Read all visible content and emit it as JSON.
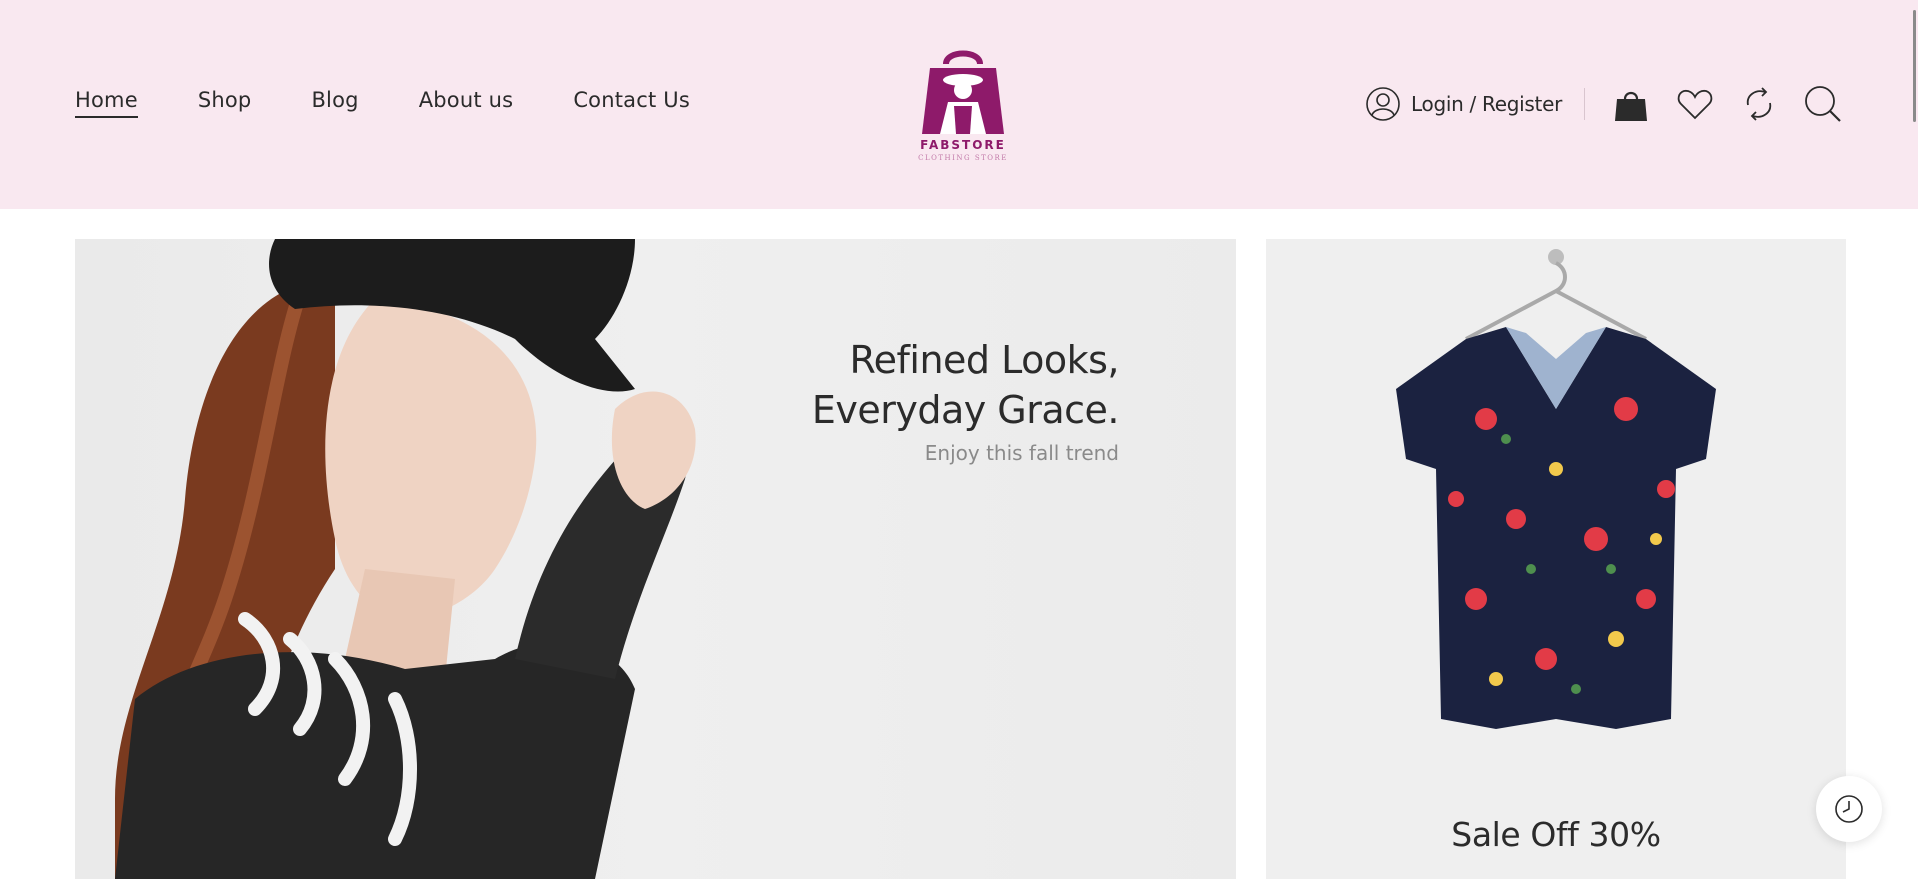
{
  "nav": {
    "items": [
      {
        "label": "Home",
        "active": true
      },
      {
        "label": "Shop",
        "active": false
      },
      {
        "label": "Blog",
        "active": false
      },
      {
        "label": "About us",
        "active": false
      },
      {
        "label": "Contact Us",
        "active": false
      }
    ]
  },
  "logo": {
    "name": "FABSTORE",
    "tagline": "CLOTHING STORE",
    "color": "#8e1a6a"
  },
  "account": {
    "login_label": "Login / Register",
    "icon": "user-icon"
  },
  "tools": {
    "icons": [
      "shopping-bag-icon",
      "heart-icon",
      "compare-icon",
      "search-icon"
    ]
  },
  "hero": {
    "title": "Refined Looks,\nEveryday Grace.",
    "subtitle": "Enjoy this fall trend"
  },
  "promo": {
    "title": "Sale Off 30%"
  },
  "floating": {
    "icon": "clock-icon"
  },
  "colors": {
    "header_bg": "#f9e8f0",
    "brand": "#8e1a6a",
    "text": "#2b2b2b"
  }
}
